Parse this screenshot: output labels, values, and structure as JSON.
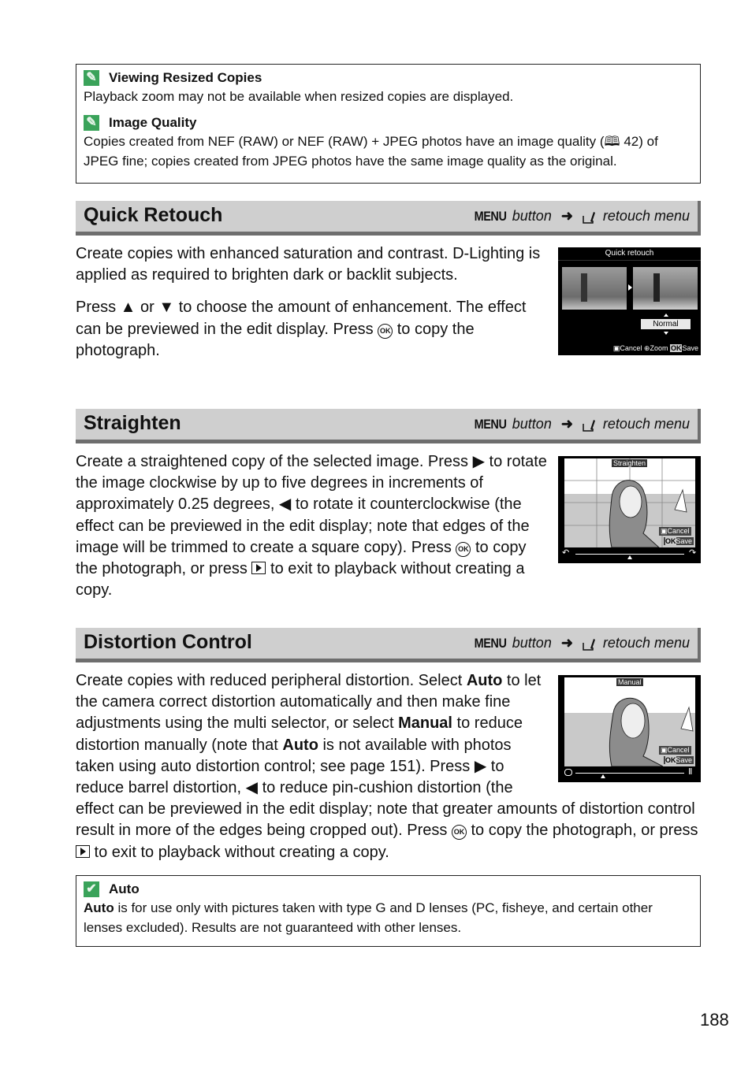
{
  "notes_top": [
    {
      "title": "Viewing Resized Copies",
      "text": "Playback zoom may not be available when resized copies are displayed.",
      "icon": "pencil-note-icon"
    },
    {
      "title": "Image Quality",
      "text_before": "Copies created from NEF (RAW) or NEF (RAW) + JPEG photos have an image quality (",
      "ref": "42",
      "text_after": ") of JPEG fine; copies created from JPEG photos have the same image quality as the original.",
      "icon": "pencil-note-icon"
    }
  ],
  "breadcrumb": {
    "menu": "MENU",
    "button": "button",
    "arrow": "➜",
    "target": "retouch menu"
  },
  "sections": [
    {
      "title": "Quick Retouch",
      "p1": "Create copies with enhanced saturation and contrast. D-Lighting is applied as required to brighten dark or backlit subjects.",
      "p2_a": "Press ▲ or ▼ to choose the amount of enhancement.  The effect can be previewed in the edit display.  Press ",
      "p2_b": " to copy the photograph.",
      "screen": {
        "title": "Quick retouch",
        "value": "Normal",
        "cancel": "Cancel",
        "zoom": "Zoom",
        "save": "Save"
      }
    },
    {
      "title": "Straighten",
      "p_a": "Create a straightened copy of the selected image.  Press ▶ to rotate the image clockwise by up to five degrees in increments of approximately 0.25 degrees, ◀ to rotate it counterclockwise (the effect can be previewed in the edit display; note that edges of the image will be trimmed to create a square copy).  Press ",
      "p_b": " to copy the photograph, or press ",
      "p_c": " to exit to playback without creating a copy.",
      "screen": {
        "title": "Straighten",
        "cancel": "Cancel",
        "save": "Save",
        "slider_position": 0.5
      }
    },
    {
      "title": "Distortion Control",
      "p_1": "Create copies with reduced peripheral distortion.  Select ",
      "auto": "Auto",
      "p_2": " to let the camera correct distortion automatically and then make fine adjustments using the multi selector, or select ",
      "manual": "Manual",
      "p_3": " to reduce distortion manually (note that ",
      "p_4": " is not available with photos taken using auto distortion control; see page 151).  Press ▶ to reduce barrel distortion, ◀ to reduce pin-cushion distortion (the effect can be previewed in the edit display; note that greater amounts of distortion control result in more of the edges being cropped out).  Press ",
      "p_5": " to copy the photograph, or press ",
      "p_6": " to exit to playback without creating a copy.",
      "screen": {
        "title": "Manual",
        "cancel": "Cancel",
        "save": "Save",
        "slider_position": 0.25
      }
    }
  ],
  "note_bottom": {
    "title": "Auto",
    "bold_lead": "Auto",
    "text": " is for use only with pictures taken with type G and D lenses (PC, fisheye, and certain other lenses excluded).  Results are not guaranteed with other lenses.",
    "icon": "checkmark-icon"
  },
  "ok_label": "OK",
  "page_number": "188",
  "colors": {
    "section_bg": "#cfcfcf",
    "section_shadow": "#6e6e6e",
    "icon_green": "#3aa35a"
  }
}
